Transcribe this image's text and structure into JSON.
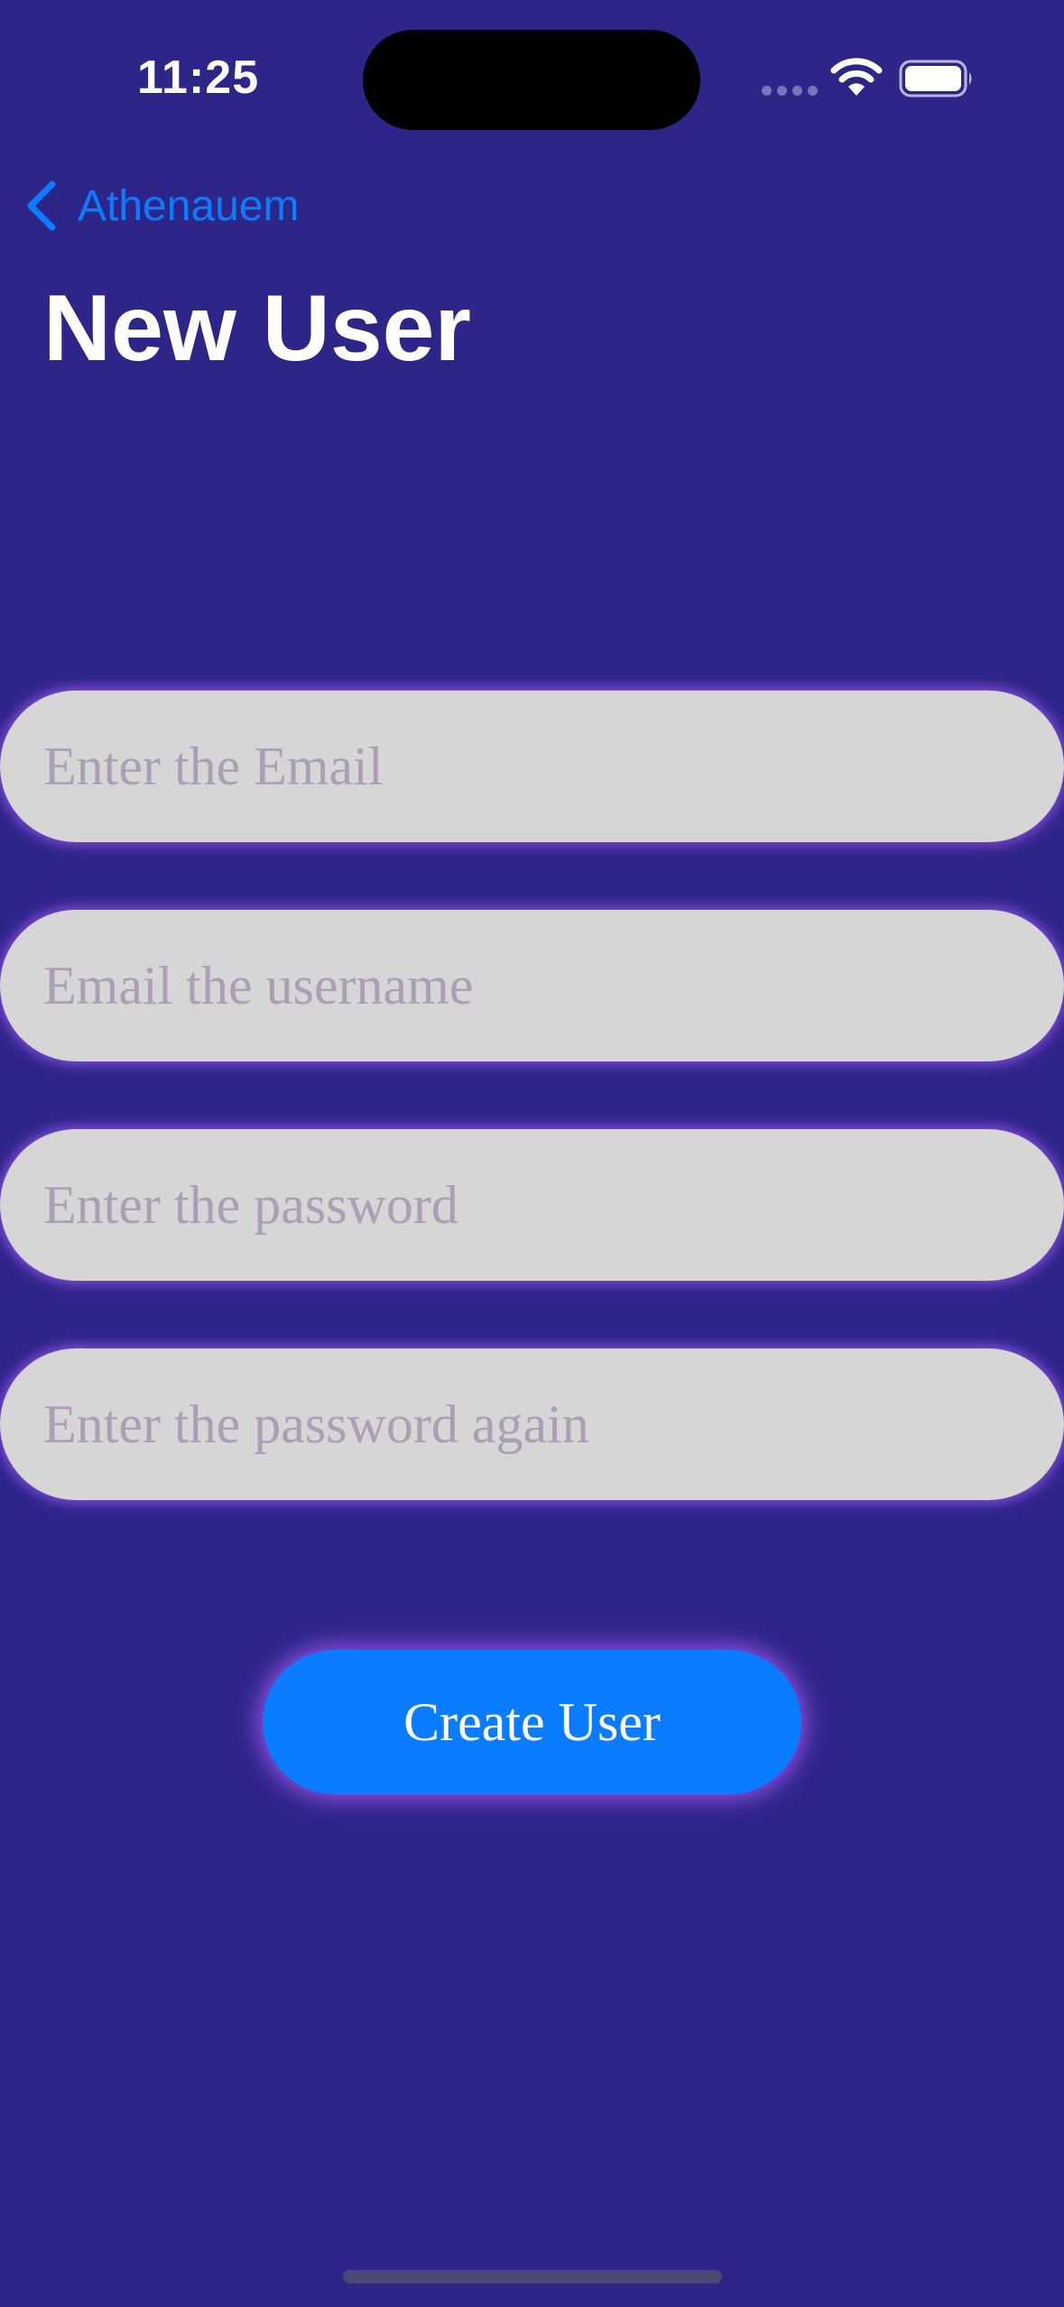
{
  "status_bar": {
    "time": "11:25",
    "icons": [
      "signal-icon",
      "wifi-icon",
      "battery-icon"
    ]
  },
  "nav": {
    "back_label": "Athenauem",
    "back_icon": "chevron-left-icon",
    "title": "New User"
  },
  "form": {
    "email_placeholder": "Enter the Email",
    "username_placeholder": "Email the username",
    "password_placeholder": "Enter the password",
    "password_again_placeholder": "Enter the password again",
    "email_value": "",
    "username_value": "",
    "password_value": "",
    "password_again_value": ""
  },
  "actions": {
    "create_label": "Create User"
  },
  "colors": {
    "background": "#2e2589",
    "accent": "#0a7cff",
    "field_background": "#d6d6d6",
    "field_glow": "#8c4fe0",
    "placeholder": "#ad9db7"
  }
}
